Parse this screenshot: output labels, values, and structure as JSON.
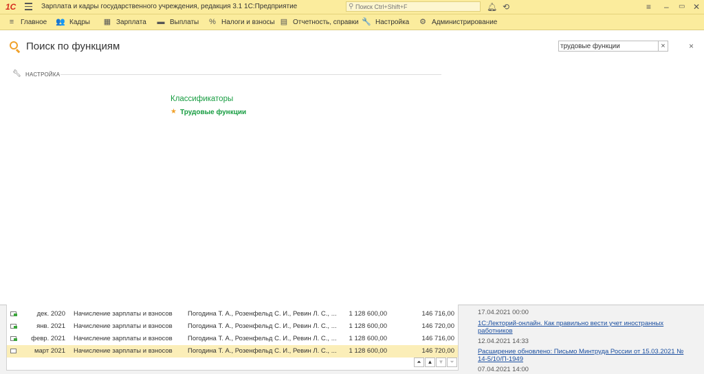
{
  "app": {
    "logo": "1С",
    "title": "Зарплата и кадры государственного учреждения, редакция 3.1 1С:Предприятие",
    "search_placeholder": "Поиск Ctrl+Shift+F"
  },
  "menu": [
    {
      "icon": "≡",
      "label": "Главное"
    },
    {
      "icon": "👥",
      "label": "Кадры"
    },
    {
      "icon": "▦",
      "label": "Зарплата"
    },
    {
      "icon": "▬",
      "label": "Выплаты"
    },
    {
      "icon": "%",
      "label": "Налоги и взносы"
    },
    {
      "icon": "▤",
      "label": "Отчетность, справки"
    },
    {
      "icon": "🔧",
      "label": "Настройка"
    },
    {
      "icon": "⚙",
      "label": "Администрирование"
    }
  ],
  "search_panel": {
    "title": "Поиск по функциям",
    "query": "трудовые функции",
    "section": "НАСТРОЙКА",
    "group_title": "Классификаторы",
    "result": "Трудовые функции"
  },
  "documents": [
    {
      "period": "дек. 2020",
      "type": "Начисление зарплаты и взносов",
      "employees": "Погодина Т. А., Розенфельд С. И., Ревин Л. С., ...",
      "amount": "1 128 600,00",
      "contributions": "146 716,00",
      "selected": false
    },
    {
      "period": "янв. 2021",
      "type": "Начисление зарплаты и взносов",
      "employees": "Погодина Т. А., Розенфельд С. И., Ревин Л. С., ...",
      "amount": "1 128 600,00",
      "contributions": "146 720,00",
      "selected": false
    },
    {
      "period": "февр. 2021",
      "type": "Начисление зарплаты и взносов",
      "employees": "Погодина Т. А., Розенфельд С. И., Ревин Л. С., ...",
      "amount": "1 128 600,00",
      "contributions": "146 716,00",
      "selected": false
    },
    {
      "period": "март 2021",
      "type": "Начисление зарплаты и взносов",
      "employees": "Погодина Т. А., Розенфельд С. И., Ревин Л. С., ...",
      "amount": "1 128 600,00",
      "contributions": "146 720,00",
      "selected": true
    }
  ],
  "news": [
    {
      "date": "17.04.2021 00:00",
      "link": "1С:Лекторий-онлайн. Как правильно вести учет иностранных работников"
    },
    {
      "date": "12.04.2021 14:33",
      "link": "Расширение обновлено: Письмо Минтруда России от 15.03.2021 № 14-5/10/П-1949"
    },
    {
      "date": "07.04.2021 14:00",
      "link": ""
    }
  ]
}
